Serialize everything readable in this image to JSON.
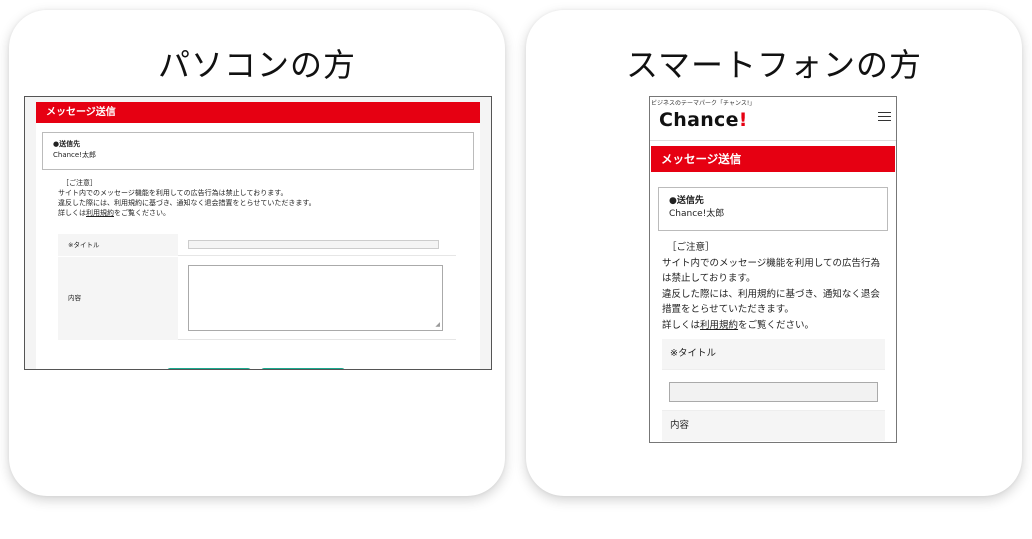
{
  "pc_card": {
    "title": "パソコンの方",
    "screen": {
      "header": "メッセージ送信",
      "dest_label": "●送信先",
      "dest_value": "Chance!太郎",
      "notice_heading": "［ご注意］",
      "notice_line1": "サイト内でのメッセージ機能を利用しての広告行為は禁止しております。",
      "notice_line2": "違反した際には、利用規約に基づき、通知なく退会措置をとらせていただきます。",
      "notice_line3_pre": "詳しくは",
      "notice_link": "利用規約",
      "notice_line3_post": "をご覧ください。",
      "title_label": "※タイトル",
      "content_label": "内容"
    }
  },
  "sp_card": {
    "title": "スマートフォンの方",
    "screen": {
      "tagline": "ビジネスのテーマパーク「チャンス!」",
      "logo_text": "Chance",
      "logo_bang": "!",
      "header": "メッセージ送信",
      "dest_label": "●送信先",
      "dest_value": "Chance!太郎",
      "notice_heading": "［ご注意］",
      "notice_line1": "サイト内でのメッセージ機能を利用しての広告行為",
      "notice_line2": "は禁止しております。",
      "notice_line3": "違反した際には、利用規約に基づき、通知なく退会",
      "notice_line4": "措置をとらせていただきます。",
      "notice_line5_pre": "詳しくは",
      "notice_link": "利用規約",
      "notice_line5_post": "をご覧ください。",
      "title_label": "※タイトル",
      "content_label": "内容"
    }
  },
  "colors": {
    "brand_red": "#e60012",
    "button_green": "#1aaa8f"
  },
  "icons": [
    "hamburger-menu-icon",
    "textarea-resize-icon"
  ]
}
